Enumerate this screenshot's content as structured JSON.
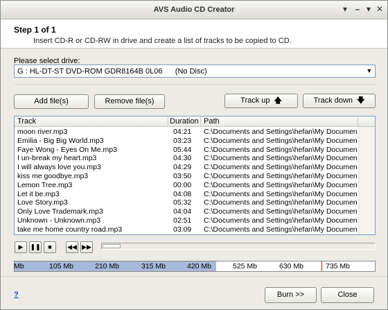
{
  "window": {
    "title": "AVS Audio CD Creator",
    "controls": [
      "▾",
      "–",
      "▾",
      "✕"
    ]
  },
  "header": {
    "step": "Step 1 of 1",
    "description": "Insert CD-R or CD-RW in drive and create a list of tracks to be copied to CD."
  },
  "drive": {
    "label": "Please select drive:",
    "value": "G : HL-DT-ST DVD-ROM GDR8164B 0L06      (No Disc)"
  },
  "buttons": {
    "add": "Add file(s)",
    "remove": "Remove file(s)",
    "track_up": "Track up",
    "track_down": "Track down",
    "burn": "Burn >>",
    "close": "Close"
  },
  "table": {
    "columns": [
      "Track",
      "Duration",
      "Path"
    ],
    "rows": [
      {
        "track": "moon river.mp3",
        "duration": "04:21",
        "path": "C:\\Documents and Settings\\hefan\\My Documen..."
      },
      {
        "track": "Emilia - Big Big World.mp3",
        "duration": "03:23",
        "path": "C:\\Documents and Settings\\hefan\\My Documen..."
      },
      {
        "track": "Faye Wong - Eyes On Me.mp3",
        "duration": "05:44",
        "path": "C:\\Documents and Settings\\hefan\\My Documen..."
      },
      {
        "track": "I un-break my heart.mp3",
        "duration": "04:30",
        "path": "C:\\Documents and Settings\\hefan\\My Documen..."
      },
      {
        "track": "I will always love you.mp3",
        "duration": "04:29",
        "path": "C:\\Documents and Settings\\hefan\\My Documen..."
      },
      {
        "track": "kiss me goodbye.mp3",
        "duration": "03:50",
        "path": "C:\\Documents and Settings\\hefan\\My Documen..."
      },
      {
        "track": "Lemon Tree.mp3",
        "duration": "00:00",
        "path": "C:\\Documents and Settings\\hefan\\My Documen..."
      },
      {
        "track": "Let it be.mp3",
        "duration": "04:08",
        "path": "C:\\Documents and Settings\\hefan\\My Documen..."
      },
      {
        "track": "Love Story.mp3",
        "duration": "05:32",
        "path": "C:\\Documents and Settings\\hefan\\My Documen..."
      },
      {
        "track": "Only Love Trademark.mp3",
        "duration": "04:04",
        "path": "C:\\Documents and Settings\\hefan\\My Documen..."
      },
      {
        "track": "Unknown - Unknown.mp3",
        "duration": "02:51",
        "path": "C:\\Documents and Settings\\hefan\\My Documen..."
      },
      {
        "track": "take me home country road.mp3",
        "duration": "03:09",
        "path": "C:\\Documents and Settings\\hefan\\My Documen..."
      }
    ]
  },
  "player": {
    "icons": [
      "play-icon",
      "pause-icon",
      "stop-icon",
      "rewind-icon",
      "fast-forward-icon"
    ],
    "position_fraction": 0
  },
  "capacity": {
    "labels": [
      "Mb",
      "105 Mb",
      "210 Mb",
      "315 Mb",
      "420 Mb",
      "525 Mb",
      "630 Mb",
      "735 Mb"
    ],
    "used_fraction": 0.56,
    "colors": {
      "used": "#a6b9db",
      "limit_marker": "#c02020"
    }
  },
  "help": {
    "label": "?"
  }
}
